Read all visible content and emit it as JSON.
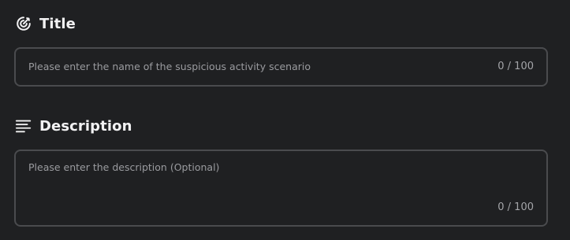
{
  "title_section": {
    "icon": "target-icon",
    "label": "Title",
    "input": {
      "value": "",
      "placeholder": "Please enter the name of the suspicious activity scenario",
      "counter": "0 / 100"
    }
  },
  "description_section": {
    "icon": "align-left-icon",
    "label": "Description",
    "textarea": {
      "value": "",
      "placeholder": "Please enter the description (Optional)",
      "counter": "0 / 100"
    }
  },
  "colors": {
    "background": "#1f2022",
    "border": "#4a4b4e",
    "placeholder_text": "#9a9b9f",
    "label_text": "#f2f2f3"
  }
}
